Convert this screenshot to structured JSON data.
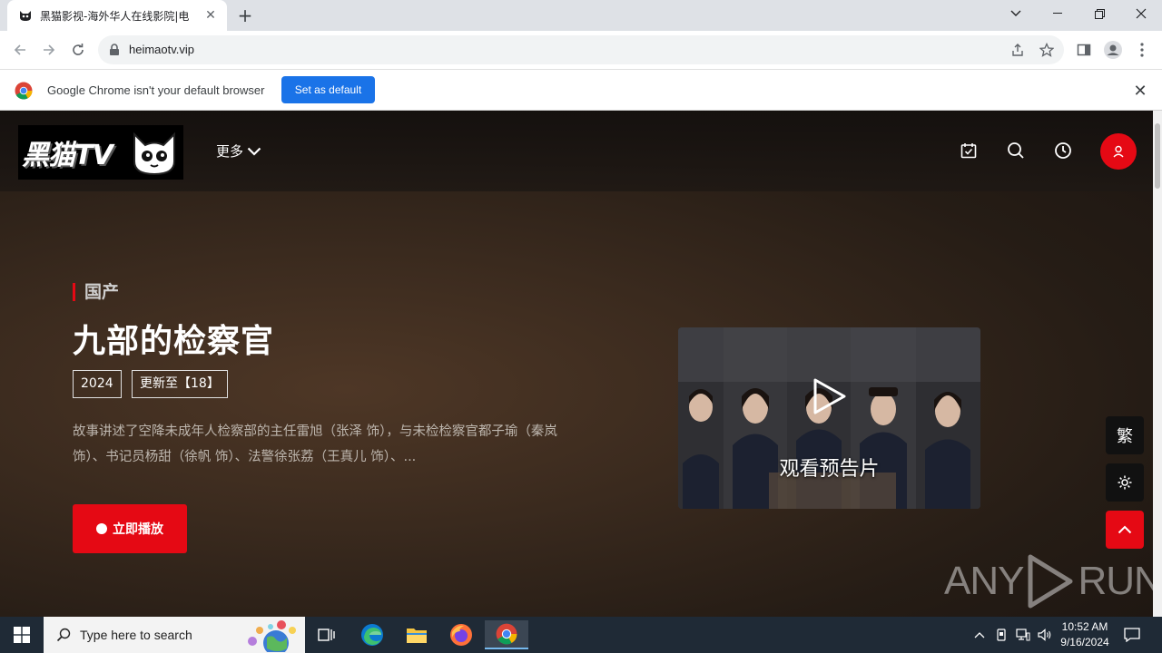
{
  "browser": {
    "tab_title": "黑猫影视-海外华人在线影院|电",
    "url": "heimaotv.vip",
    "infobar_text": "Google Chrome isn't your default browser",
    "infobar_button": "Set as default"
  },
  "site": {
    "logo_text": "黑猫TV",
    "nav_more": "更多"
  },
  "hero": {
    "category": "国产",
    "title": "九部的检察官",
    "year": "2024",
    "episode": "更新至【18】",
    "description": "故事讲述了空降未成年人检察部的主任雷旭（张泽 饰），与未检检察官都子瑜（秦岚 饰）、书记员杨甜（徐帆 饰）、法警徐张荔（王真儿 饰）、...",
    "play_label": "立即播放",
    "trailer_label": "观看预告片"
  },
  "side_tools": {
    "traditional": "繁"
  },
  "watermark": {
    "left": "ANY",
    "right": "RUN"
  },
  "taskbar": {
    "search_placeholder": "Type here to search",
    "time": "10:52 AM",
    "date": "9/16/2024"
  },
  "colors": {
    "accent_red": "#e50914",
    "chrome_blue": "#1a73e8",
    "taskbar": "#1f2a36"
  }
}
